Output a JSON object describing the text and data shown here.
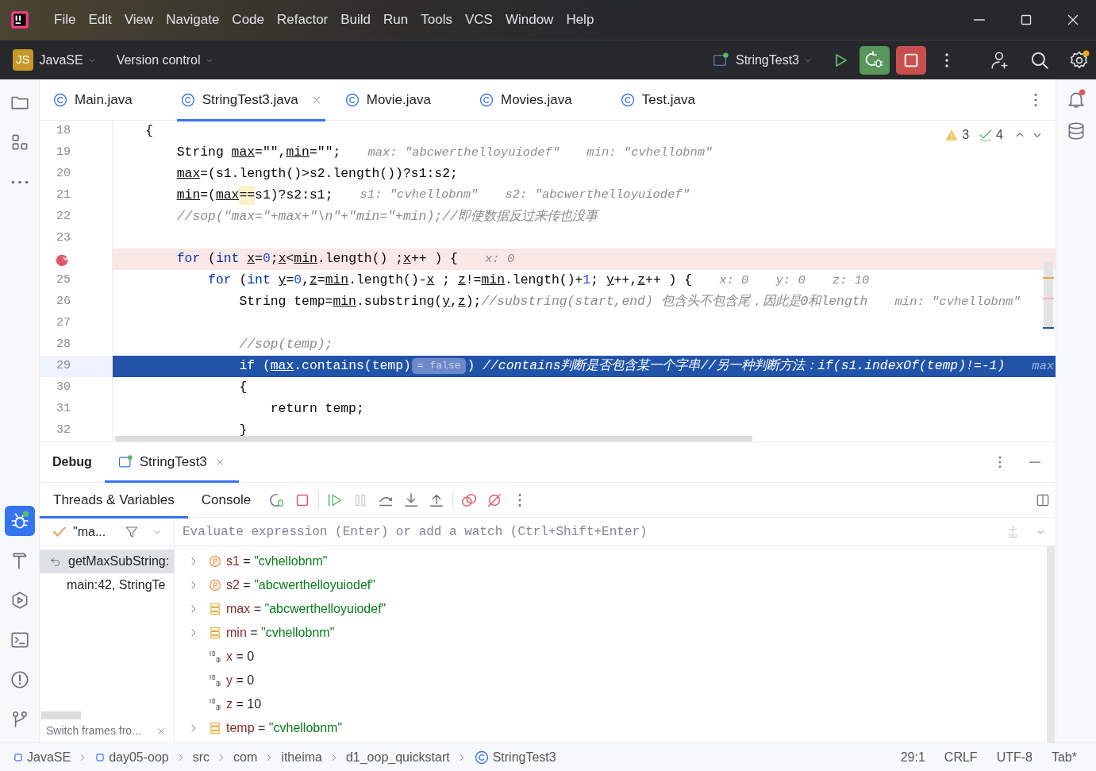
{
  "menu": [
    "File",
    "Edit",
    "View",
    "Navigate",
    "Code",
    "Refactor",
    "Build",
    "Run",
    "Tools",
    "VCS",
    "Window",
    "Help"
  ],
  "toolbar": {
    "project_badge": "JS",
    "project": "JavaSE",
    "vcs": "Version control",
    "run_config": "StringTest3"
  },
  "left_tool_strip": [
    {
      "selected": false
    },
    {
      "selected": false
    },
    {
      "selected": false
    },
    {
      "selected": true
    },
    {
      "selected": false
    },
    {
      "selected": false
    },
    {
      "selected": false
    },
    {
      "selected": false
    },
    {
      "selected": false
    }
  ],
  "editor_tabs": [
    {
      "label": "Main.java",
      "selected": false
    },
    {
      "label": "StringTest3.java",
      "selected": true
    },
    {
      "label": "Movie.java",
      "selected": false
    },
    {
      "label": "Movies.java",
      "selected": false
    },
    {
      "label": "Test.java",
      "selected": false
    }
  ],
  "inspections": {
    "warnings": "3",
    "weak_warnings": "4"
  },
  "code_lines": [
    {
      "number": "18",
      "breakpoint": false,
      "current": false,
      "segments": [
        {
          "kind": "code",
          "text": "    {"
        }
      ]
    },
    {
      "number": "19",
      "breakpoint": false,
      "current": false,
      "segments": [
        {
          "kind": "code",
          "text": "        String "
        },
        {
          "kind": "var",
          "text": "max"
        },
        {
          "kind": "code",
          "text": "=\"\","
        },
        {
          "kind": "var",
          "text": "min"
        },
        {
          "kind": "code",
          "text": "=\"\";"
        },
        {
          "kind": "hint",
          "text": "max: \"abcwerthelloyuiodef\""
        },
        {
          "kind": "hint",
          "text": "min: \"cvhellobnm\""
        }
      ]
    },
    {
      "number": "20",
      "breakpoint": false,
      "current": false,
      "segments": [
        {
          "kind": "var",
          "text": "        max"
        },
        {
          "kind": "code",
          "text": "=(s1.length()>s2.length())?s1:s2;"
        }
      ]
    },
    {
      "number": "21",
      "breakpoint": false,
      "current": false,
      "segments": [
        {
          "kind": "var",
          "text": "        min"
        },
        {
          "kind": "code",
          "text": "=("
        },
        {
          "kind": "var",
          "text": "max"
        },
        {
          "kind": "match",
          "text": "=="
        },
        {
          "kind": "code",
          "text": "s1)?s2:s1;"
        },
        {
          "kind": "hint",
          "text": "s1: \"cvhellobnm\""
        },
        {
          "kind": "hint",
          "text": "s2: \"abcwerthelloyuiodef\""
        }
      ]
    },
    {
      "number": "22",
      "breakpoint": false,
      "current": false,
      "segments": [
        {
          "kind": "comment",
          "text": "        //sop(\"max=\"+max+\"\\n\"+\"min=\"+min);//即使数据反过来传也没事"
        }
      ]
    },
    {
      "number": "23",
      "breakpoint": false,
      "current": false
    },
    {
      "breakpoint": true,
      "current": false,
      "segments": [
        {
          "kind": "keyword",
          "text": "        for"
        },
        {
          "kind": "code",
          "text": " ("
        },
        {
          "kind": "keyword",
          "text": "int"
        },
        {
          "kind": "var",
          "text": " x"
        },
        {
          "kind": "code",
          "text": "="
        },
        {
          "kind": "number",
          "text": "0"
        },
        {
          "kind": "code",
          "text": ";"
        },
        {
          "kind": "var",
          "text": "x"
        },
        {
          "kind": "code",
          "text": "<"
        },
        {
          "kind": "var",
          "text": "min"
        },
        {
          "kind": "code",
          "text": ".length() ;"
        },
        {
          "kind": "var",
          "text": "x"
        },
        {
          "kind": "code",
          "text": "++ ) {"
        },
        {
          "kind": "hint",
          "text": "x: 0"
        }
      ]
    },
    {
      "number": "25",
      "breakpoint": false,
      "current": false,
      "segments": [
        {
          "kind": "keyword",
          "text": "            for"
        },
        {
          "kind": "code",
          "text": " ("
        },
        {
          "kind": "keyword",
          "text": "int"
        },
        {
          "kind": "var",
          "text": " y"
        },
        {
          "kind": "code",
          "text": "="
        },
        {
          "kind": "number",
          "text": "0"
        },
        {
          "kind": "code",
          "text": ","
        },
        {
          "kind": "var",
          "text": "z"
        },
        {
          "kind": "code",
          "text": "="
        },
        {
          "kind": "var",
          "text": "min"
        },
        {
          "kind": "code",
          "text": ".length()-"
        },
        {
          "kind": "var",
          "text": "x"
        },
        {
          "kind": "code",
          "text": " ; "
        },
        {
          "kind": "var",
          "text": "z"
        },
        {
          "kind": "code",
          "text": "!="
        },
        {
          "kind": "var",
          "text": "min"
        },
        {
          "kind": "code",
          "text": ".length()+"
        },
        {
          "kind": "number",
          "text": "1"
        },
        {
          "kind": "code",
          "text": "; "
        },
        {
          "kind": "var",
          "text": "y"
        },
        {
          "kind": "code",
          "text": "++,"
        },
        {
          "kind": "var",
          "text": "z"
        },
        {
          "kind": "code",
          "text": "++ ) {"
        },
        {
          "kind": "hint",
          "text": "x: 0"
        },
        {
          "kind": "hint",
          "text": "y: 0"
        },
        {
          "kind": "hint",
          "text": "z: 10"
        }
      ]
    },
    {
      "number": "26",
      "breakpoint": false,
      "current": false,
      "segments": [
        {
          "kind": "code",
          "text": "                String temp="
        },
        {
          "kind": "var",
          "text": "min"
        },
        {
          "kind": "code",
          "text": ".substring("
        },
        {
          "kind": "var",
          "text": "y"
        },
        {
          "kind": "code",
          "text": ","
        },
        {
          "kind": "var",
          "text": "z"
        },
        {
          "kind": "code",
          "text": ");"
        },
        {
          "kind": "comment",
          "text": "//substring(start,end) 包含头不包含尾，因此是0和length"
        },
        {
          "kind": "hint",
          "text": "min: \"cvhellobnm\""
        }
      ]
    },
    {
      "number": "27",
      "breakpoint": false,
      "current": false
    },
    {
      "number": "28",
      "breakpoint": false,
      "current": false,
      "segments": [
        {
          "kind": "comment",
          "text": "                //sop(temp);"
        }
      ]
    },
    {
      "number": "29",
      "breakpoint": false,
      "current": true,
      "segments": [
        {
          "kind": "keyword",
          "text": "                if"
        },
        {
          "kind": "code",
          "text": " ("
        },
        {
          "kind": "var",
          "text": "max"
        },
        {
          "kind": "code",
          "text": ".contains(temp)"
        },
        {
          "kind": "inline_value",
          "text": "= false"
        },
        {
          "kind": "code",
          "text": ") "
        },
        {
          "kind": "comment",
          "text": "//contains判断是否包含某一个字串//另一种判断方法：if(s1.indexOf(temp)!=-1)"
        },
        {
          "kind": "hint",
          "text": "max"
        }
      ]
    },
    {
      "number": "30",
      "breakpoint": false,
      "current": false,
      "segments": [
        {
          "kind": "code",
          "text": "                {"
        }
      ]
    },
    {
      "number": "31",
      "breakpoint": false,
      "current": false,
      "segments": [
        {
          "kind": "code",
          "text": "                    return temp;"
        }
      ]
    },
    {
      "number": "32",
      "breakpoint": false,
      "current": false,
      "segments": [
        {
          "kind": "code",
          "text": "                }"
        }
      ]
    }
  ],
  "debug": {
    "title": "Debug",
    "session_tab": {
      "label": "StringTest3",
      "selected": true
    },
    "subtabs": [
      {
        "label": "Threads & Variables",
        "selected": true
      },
      {
        "label": "Console",
        "selected": false
      }
    ],
    "thread": "\"ma...",
    "evaluate_placeholder": "Evaluate expression (Enter) or add a watch (Ctrl+Shift+Enter)",
    "frames": [
      {
        "label": "getMaxSubString:",
        "selected": true
      },
      {
        "label": "main:42, StringTe",
        "selected": false
      }
    ],
    "frames_hint": "Switch frames fro...",
    "variables": [
      {
        "kind": "param",
        "expandable": true,
        "name": "s1",
        "operator": "=",
        "value": "\"cvhellobnm\""
      },
      {
        "kind": "param",
        "expandable": true,
        "name": "s2",
        "operator": "=",
        "value": "\"abcwerthelloyuiodef\""
      },
      {
        "kind": "object",
        "expandable": true,
        "name": "max",
        "operator": "=",
        "value": "\"abcwerthelloyuiodef\""
      },
      {
        "kind": "object",
        "expandable": true,
        "name": "min",
        "operator": "=",
        "value": "\"cvhellobnm\""
      },
      {
        "kind": "primitive",
        "expandable": false,
        "name": "x",
        "operator": "=",
        "value": "0"
      },
      {
        "kind": "primitive",
        "expandable": false,
        "name": "y",
        "operator": "=",
        "value": "0"
      },
      {
        "kind": "primitive",
        "expandable": false,
        "name": "z",
        "operator": "=",
        "value": "10"
      },
      {
        "kind": "object",
        "expandable": true,
        "name": "temp",
        "operator": "=",
        "value": "\"cvhellobnm\""
      }
    ]
  },
  "status_bar": {
    "breadcrumbs": [
      {
        "kind": "module",
        "label": "JavaSE"
      },
      {
        "kind": "module",
        "label": "day05-oop"
      },
      {
        "kind": "folder",
        "label": "src"
      },
      {
        "kind": "folder",
        "label": "com"
      },
      {
        "kind": "folder",
        "label": "itheima"
      },
      {
        "kind": "folder",
        "label": "d1_oop_quickstart"
      },
      {
        "kind": "class",
        "label": "StringTest3"
      }
    ],
    "position": "29:1",
    "line_separator": "CRLF",
    "encoding": "UTF-8",
    "indent": "Tab*"
  }
}
